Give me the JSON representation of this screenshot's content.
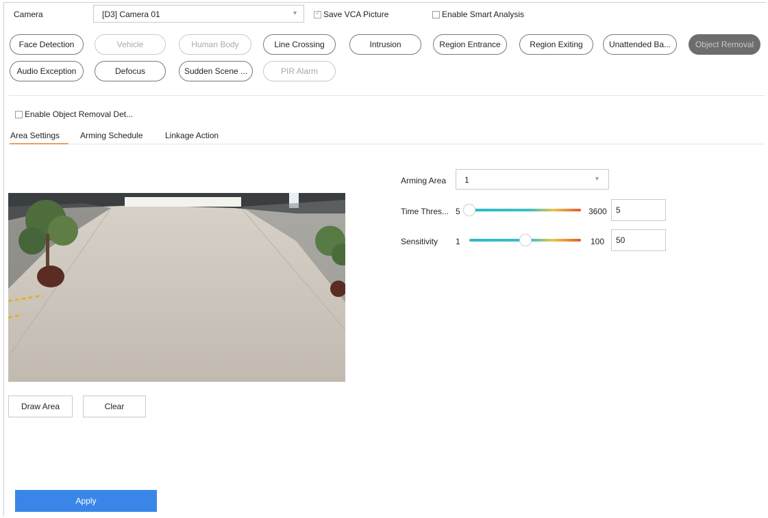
{
  "header": {
    "camera_label": "Camera",
    "camera_value": "[D3] Camera 01",
    "save_vca_picture": "Save VCA Picture",
    "enable_smart_analysis": "Enable Smart Analysis"
  },
  "event_types": [
    {
      "label": "Face Detection",
      "state": "normal"
    },
    {
      "label": "Vehicle",
      "state": "disabled"
    },
    {
      "label": "Human Body",
      "state": "disabled"
    },
    {
      "label": "Line Crossing",
      "state": "normal"
    },
    {
      "label": "Intrusion",
      "state": "normal"
    },
    {
      "label": "Region Entrance",
      "state": "normal"
    },
    {
      "label": "Region Exiting",
      "state": "normal"
    },
    {
      "label": "Unattended Ba...",
      "state": "normal"
    },
    {
      "label": "Object Removal",
      "state": "active"
    },
    {
      "label": "Audio Exception",
      "state": "normal"
    },
    {
      "label": "Defocus",
      "state": "normal"
    },
    {
      "label": "Sudden Scene ...",
      "state": "normal"
    },
    {
      "label": "PIR Alarm",
      "state": "disabled"
    }
  ],
  "enable_detection": "Enable Object Removal Det...",
  "tabs": [
    "Area Settings",
    "Arming Schedule",
    "Linkage Action"
  ],
  "active_tab": "Area Settings",
  "buttons": {
    "draw_area": "Draw Area",
    "clear": "Clear",
    "apply": "Apply"
  },
  "arming_area": {
    "label": "Arming Area",
    "value": "1"
  },
  "time_threshold": {
    "label": "Time Thres...",
    "min": "5",
    "max": "3600",
    "value": "5",
    "fraction": 0.0
  },
  "sensitivity": {
    "label": "Sensitivity",
    "min": "1",
    "max": "100",
    "value": "50",
    "fraction": 0.5
  },
  "colors": {
    "accent_underline": "#e8a06a",
    "apply_button": "#3a86e8",
    "active_pill": "#6d6d6d"
  }
}
